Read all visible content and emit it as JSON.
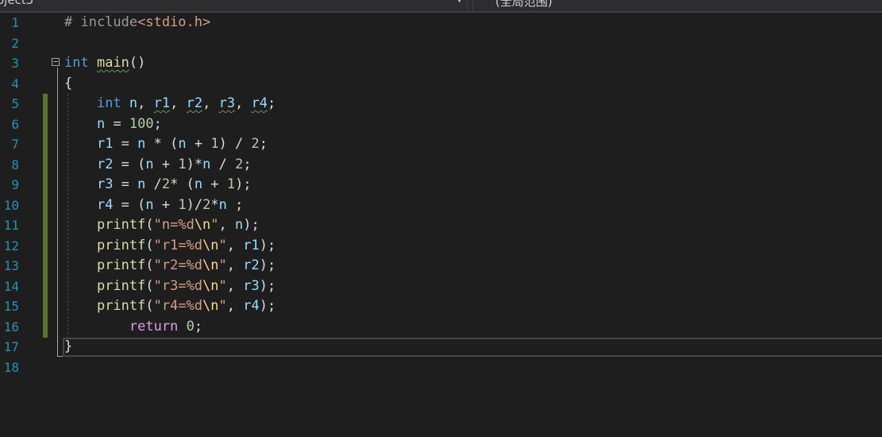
{
  "navbar": {
    "project_label": "oject5",
    "scope_label": "(全局范围)"
  },
  "editor": {
    "line_numbers": [
      "1",
      "2",
      "3",
      "4",
      "5",
      "6",
      "7",
      "8",
      "9",
      "10",
      "11",
      "12",
      "13",
      "14",
      "15",
      "16",
      "17",
      "18"
    ],
    "lines": [
      [
        {
          "t": "# include",
          "c": "pp"
        },
        {
          "t": "<stdio.h>",
          "c": "str"
        }
      ],
      [],
      [
        {
          "t": "int",
          "c": "kw"
        },
        {
          "t": " ",
          "c": "plain"
        },
        {
          "t": "main",
          "c": "fn",
          "sq": true
        },
        {
          "t": "()",
          "c": "plain"
        }
      ],
      [
        {
          "t": "{",
          "c": "plain"
        }
      ],
      [
        {
          "t": "    ",
          "c": "plain"
        },
        {
          "t": "int",
          "c": "kw"
        },
        {
          "t": " ",
          "c": "plain"
        },
        {
          "t": "n",
          "c": "var"
        },
        {
          "t": ", ",
          "c": "plain"
        },
        {
          "t": "r1",
          "c": "var",
          "sq": true
        },
        {
          "t": ", ",
          "c": "plain"
        },
        {
          "t": "r2",
          "c": "var",
          "sq": true
        },
        {
          "t": ", ",
          "c": "plain"
        },
        {
          "t": "r3",
          "c": "var",
          "sq": true
        },
        {
          "t": ", ",
          "c": "plain"
        },
        {
          "t": "r4",
          "c": "var",
          "sq": true
        },
        {
          "t": ";",
          "c": "plain"
        }
      ],
      [
        {
          "t": "    ",
          "c": "plain"
        },
        {
          "t": "n",
          "c": "var"
        },
        {
          "t": " = ",
          "c": "plain"
        },
        {
          "t": "100",
          "c": "num"
        },
        {
          "t": ";",
          "c": "plain"
        }
      ],
      [
        {
          "t": "    ",
          "c": "plain"
        },
        {
          "t": "r1",
          "c": "var"
        },
        {
          "t": " = ",
          "c": "plain"
        },
        {
          "t": "n",
          "c": "var"
        },
        {
          "t": " * (",
          "c": "plain"
        },
        {
          "t": "n",
          "c": "var"
        },
        {
          "t": " + ",
          "c": "plain"
        },
        {
          "t": "1",
          "c": "num"
        },
        {
          "t": ") / ",
          "c": "plain"
        },
        {
          "t": "2",
          "c": "num"
        },
        {
          "t": ";",
          "c": "plain"
        }
      ],
      [
        {
          "t": "    ",
          "c": "plain"
        },
        {
          "t": "r2",
          "c": "var"
        },
        {
          "t": " = (",
          "c": "plain"
        },
        {
          "t": "n",
          "c": "var"
        },
        {
          "t": " + ",
          "c": "plain"
        },
        {
          "t": "1",
          "c": "num"
        },
        {
          "t": ")*",
          "c": "plain"
        },
        {
          "t": "n",
          "c": "var"
        },
        {
          "t": " / ",
          "c": "plain"
        },
        {
          "t": "2",
          "c": "num"
        },
        {
          "t": ";",
          "c": "plain"
        }
      ],
      [
        {
          "t": "    ",
          "c": "plain"
        },
        {
          "t": "r3",
          "c": "var"
        },
        {
          "t": " = ",
          "c": "plain"
        },
        {
          "t": "n",
          "c": "var"
        },
        {
          "t": " /",
          "c": "plain"
        },
        {
          "t": "2",
          "c": "num"
        },
        {
          "t": "* (",
          "c": "plain"
        },
        {
          "t": "n",
          "c": "var"
        },
        {
          "t": " + ",
          "c": "plain"
        },
        {
          "t": "1",
          "c": "num"
        },
        {
          "t": ");",
          "c": "plain"
        }
      ],
      [
        {
          "t": "    ",
          "c": "plain"
        },
        {
          "t": "r4",
          "c": "var"
        },
        {
          "t": " = (",
          "c": "plain"
        },
        {
          "t": "n",
          "c": "var"
        },
        {
          "t": " + ",
          "c": "plain"
        },
        {
          "t": "1",
          "c": "num"
        },
        {
          "t": ")/",
          "c": "plain"
        },
        {
          "t": "2",
          "c": "num"
        },
        {
          "t": "*",
          "c": "plain"
        },
        {
          "t": "n",
          "c": "var"
        },
        {
          "t": " ;",
          "c": "plain"
        }
      ],
      [
        {
          "t": "    ",
          "c": "plain"
        },
        {
          "t": "printf",
          "c": "fn"
        },
        {
          "t": "(",
          "c": "plain"
        },
        {
          "t": "\"n=%d",
          "c": "str"
        },
        {
          "t": "\\n",
          "c": "esc"
        },
        {
          "t": "\"",
          "c": "str"
        },
        {
          "t": ", ",
          "c": "plain"
        },
        {
          "t": "n",
          "c": "var"
        },
        {
          "t": ");",
          "c": "plain"
        }
      ],
      [
        {
          "t": "    ",
          "c": "plain"
        },
        {
          "t": "printf",
          "c": "fn"
        },
        {
          "t": "(",
          "c": "plain"
        },
        {
          "t": "\"r1=%d",
          "c": "str"
        },
        {
          "t": "\\n",
          "c": "esc"
        },
        {
          "t": "\"",
          "c": "str"
        },
        {
          "t": ", ",
          "c": "plain"
        },
        {
          "t": "r1",
          "c": "var"
        },
        {
          "t": ");",
          "c": "plain"
        }
      ],
      [
        {
          "t": "    ",
          "c": "plain"
        },
        {
          "t": "printf",
          "c": "fn"
        },
        {
          "t": "(",
          "c": "plain"
        },
        {
          "t": "\"r2=%d",
          "c": "str"
        },
        {
          "t": "\\n",
          "c": "esc"
        },
        {
          "t": "\"",
          "c": "str"
        },
        {
          "t": ", ",
          "c": "plain"
        },
        {
          "t": "r2",
          "c": "var"
        },
        {
          "t": ");",
          "c": "plain"
        }
      ],
      [
        {
          "t": "    ",
          "c": "plain"
        },
        {
          "t": "printf",
          "c": "fn"
        },
        {
          "t": "(",
          "c": "plain"
        },
        {
          "t": "\"r3=%d",
          "c": "str"
        },
        {
          "t": "\\n",
          "c": "esc"
        },
        {
          "t": "\"",
          "c": "str"
        },
        {
          "t": ", ",
          "c": "plain"
        },
        {
          "t": "r3",
          "c": "var"
        },
        {
          "t": ");",
          "c": "plain"
        }
      ],
      [
        {
          "t": "    ",
          "c": "plain"
        },
        {
          "t": "printf",
          "c": "fn"
        },
        {
          "t": "(",
          "c": "plain"
        },
        {
          "t": "\"r4=%d",
          "c": "str"
        },
        {
          "t": "\\n",
          "c": "esc"
        },
        {
          "t": "\"",
          "c": "str"
        },
        {
          "t": ", ",
          "c": "plain"
        },
        {
          "t": "r4",
          "c": "var"
        },
        {
          "t": ");",
          "c": "plain"
        }
      ],
      [
        {
          "t": "        ",
          "c": "plain"
        },
        {
          "t": "return",
          "c": "ret"
        },
        {
          "t": " ",
          "c": "plain"
        },
        {
          "t": "0",
          "c": "num"
        },
        {
          "t": ";",
          "c": "plain"
        }
      ],
      [
        {
          "t": "}",
          "c": "plain"
        }
      ],
      []
    ]
  },
  "colors": {
    "background": "#1e1e1e",
    "line_number": "#2b91af",
    "keyword": "#569cd6",
    "return_keyword": "#d8a0df",
    "function": "#dcdcaa",
    "variable": "#9cdcfe",
    "number": "#b5cea8",
    "string": "#d69d85",
    "preprocessor": "#9b9b9b",
    "escape": "#ffd68f",
    "change_bar": "#57752e"
  }
}
